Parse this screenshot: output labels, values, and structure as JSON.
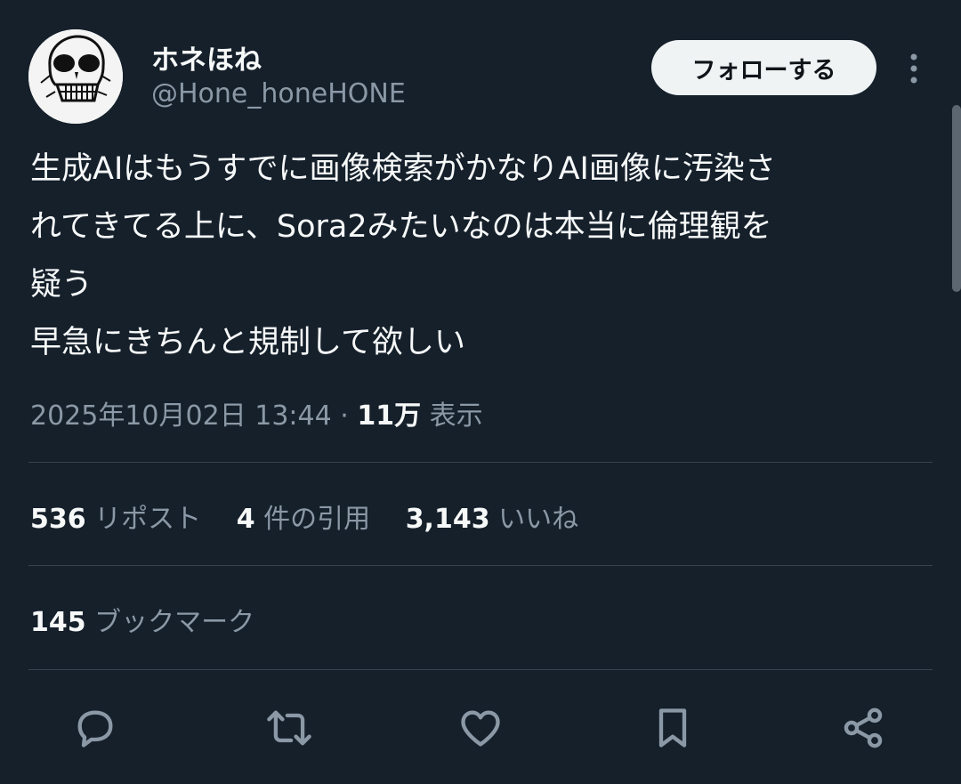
{
  "author": {
    "display_name": "ホネほね",
    "handle": "@Hone_honeHONE",
    "avatar_icon": "skull-avatar"
  },
  "follow_button": {
    "label": "フォローする"
  },
  "more_icon": "more-vertical-icon",
  "tweet": {
    "lines": [
      "生成AIはもうすでに画像検索がかなりAI画像に汚染さ",
      "れてきてる上に、Sora2みたいなのは本当に倫理観を",
      "疑う",
      "早急にきちんと規制して欲しい"
    ]
  },
  "meta": {
    "timestamp": "2025年10月02日 13:44",
    "separator": "·",
    "views_count": "11万",
    "views_label": "表示"
  },
  "stats": {
    "reposts": {
      "count": "536",
      "label": "リポスト"
    },
    "quotes": {
      "count": "4",
      "label": "件の引用"
    },
    "likes": {
      "count": "3,143",
      "label": "いいね"
    },
    "bookmarks": {
      "count": "145",
      "label": "ブックマーク"
    }
  },
  "actions": [
    "reply-icon",
    "repost-icon",
    "like-icon",
    "bookmark-icon",
    "share-icon"
  ],
  "colors": {
    "background": "#15202b",
    "text": "#f7f9f9",
    "secondary_text": "#8b98a5",
    "divider": "#38444d",
    "follow_button_bg": "#eff3f4"
  }
}
